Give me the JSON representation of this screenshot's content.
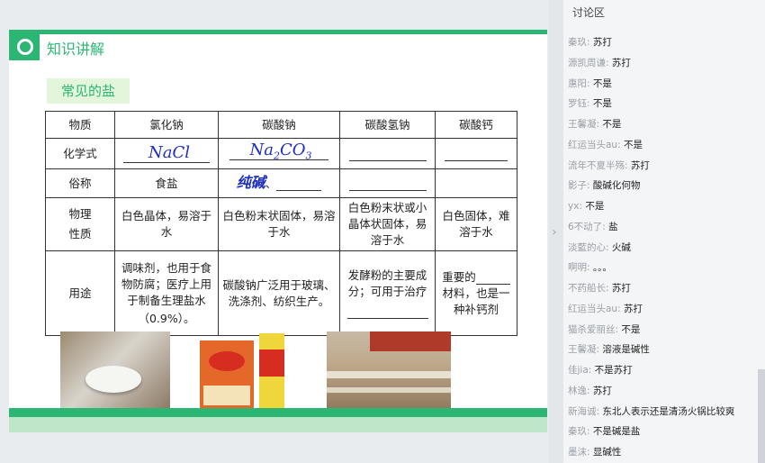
{
  "slide": {
    "title": "知识讲解",
    "section": "常见的盐",
    "table": {
      "headers": [
        "物质",
        "氯化钠",
        "碳酸钠",
        "碳酸氢钠",
        "碳酸钙"
      ],
      "row_formula": {
        "label": "化学式",
        "nacl": "NaCl",
        "na2co3": "Na2CO3"
      },
      "row_name": {
        "label": "俗称",
        "nacl": "食盐",
        "na2co3_hw": "纯碱",
        "na2co3_sep": "、"
      },
      "row_props": {
        "label": "物理性质",
        "nacl": "白色晶体，易溶于水",
        "na2co3": "白色粉末状固体，易溶于水",
        "nahco3": "白色粉末状或小晶体状固体，易溶于水",
        "caco3": "白色固体，难溶于水"
      },
      "row_use": {
        "label": "用途",
        "nacl": "调味剂，也用于食物防腐；医疗上用于制备生理盐水",
        "nacl_pct": "（0.9%）。",
        "na2co3": "碳酸钠广泛用于玻璃、洗涤剂、纺织生产。",
        "nahco3": "发酵粉的主要成分；可用于治疗",
        "caco3_a": "重要的",
        "caco3_b": "材料，也是一种补钙剂"
      }
    }
  },
  "chat": {
    "title": "讨论区",
    "messages": [
      {
        "name": "秦玖",
        "text": "苏打"
      },
      {
        "name": "源凯周谦",
        "text": "苏打"
      },
      {
        "name": "惠阳",
        "text": "不是"
      },
      {
        "name": "罗钰",
        "text": "不是"
      },
      {
        "name": "王馨凝",
        "text": "不是"
      },
      {
        "name": "红运当头au",
        "text": "不是"
      },
      {
        "name": "流年不夏半殇",
        "text": "苏打"
      },
      {
        "name": "影子",
        "text": "酸碱化何物"
      },
      {
        "name": "yx",
        "text": "不是"
      },
      {
        "name": "6不动了",
        "text": "盐"
      },
      {
        "name": "淡藍的心",
        "text": "火碱"
      },
      {
        "name": "啊明",
        "text": "。。。"
      },
      {
        "name": "不药船长",
        "text": "苏打"
      },
      {
        "name": "红运当头au",
        "text": "苏打"
      },
      {
        "name": "猫杀爱丽丝",
        "text": "不是"
      },
      {
        "name": "王馨凝",
        "text": "溶液是碱性"
      },
      {
        "name": "佳jia",
        "text": "不是苏打"
      },
      {
        "name": "林逸",
        "text": "苏打"
      },
      {
        "name": "新海诚",
        "text": "东北人表示还是清汤火锅比较爽"
      },
      {
        "name": "秦玖",
        "text": "不是碱是盐"
      },
      {
        "name": "墨沫",
        "text": "显碱性"
      }
    ]
  },
  "colors": {
    "brand_green": "#2bb673",
    "ink_blue": "#1d2fbd"
  }
}
